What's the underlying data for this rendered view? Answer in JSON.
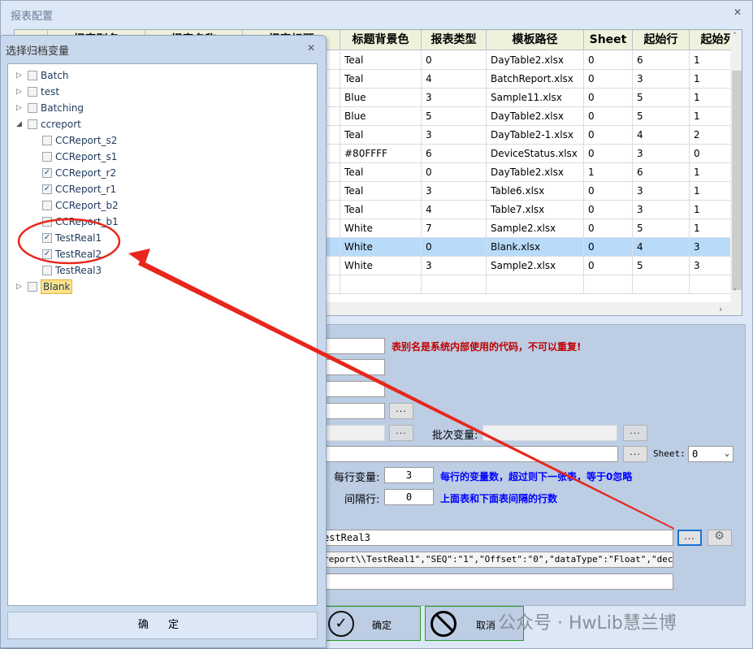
{
  "main_window": {
    "title": "报表配置",
    "close_icon": "close-icon"
  },
  "grid": {
    "columns": [
      "",
      "报表别名",
      "报表名称",
      "报表标题",
      "标题背景色",
      "报表类型",
      "模板路径",
      "Sheet",
      "起始行",
      "起始列"
    ],
    "rows": [
      {
        "bg": "Teal",
        "type": "0",
        "template": "DayTable2.xlsx",
        "sheet": "0",
        "start_row": "6",
        "start_col": "1"
      },
      {
        "bg": "Teal",
        "type": "4",
        "template": "BatchReport.xlsx",
        "sheet": "0",
        "start_row": "3",
        "start_col": "1"
      },
      {
        "bg": "Blue",
        "type": "3",
        "template": "Sample11.xlsx",
        "sheet": "0",
        "start_row": "5",
        "start_col": "1"
      },
      {
        "bg": "Blue",
        "type": "5",
        "template": "DayTable2.xlsx",
        "sheet": "0",
        "start_row": "5",
        "start_col": "1"
      },
      {
        "bg": "Teal",
        "type": "3",
        "template": "DayTable2-1.xlsx",
        "sheet": "0",
        "start_row": "4",
        "start_col": "2"
      },
      {
        "bg": "#80FFFF",
        "type": "6",
        "template": "DeviceStatus.xlsx",
        "sheet": "0",
        "start_row": "3",
        "start_col": "0"
      },
      {
        "bg": "Teal",
        "type": "0",
        "template": "DayTable2.xlsx",
        "sheet": "1",
        "start_row": "6",
        "start_col": "1"
      },
      {
        "bg": "Teal",
        "type": "3",
        "template": "Table6.xlsx",
        "sheet": "0",
        "start_row": "3",
        "start_col": "1"
      },
      {
        "bg": "Teal",
        "type": "4",
        "template": "Table7.xlsx",
        "sheet": "0",
        "start_row": "3",
        "start_col": "1"
      },
      {
        "bg": "White",
        "type": "7",
        "template": "Sample2.xlsx",
        "sheet": "0",
        "start_row": "5",
        "start_col": "1"
      },
      {
        "bg": "White",
        "type": "0",
        "template": "Blank.xlsx",
        "sheet": "0",
        "start_row": "4",
        "start_col": "3",
        "selected": true
      },
      {
        "bg": "White",
        "type": "3",
        "template": "Sample2.xlsx",
        "sheet": "0",
        "start_row": "5",
        "start_col": "3"
      }
    ]
  },
  "form": {
    "alias_hint": "表别名是系统内部使用的代码，不可以重复!",
    "browse_label": "...",
    "batch_var_label": "批次变量:",
    "sheet_label": "Sheet:",
    "sheet_value": "0",
    "vars_per_row_label": "每行变量:",
    "vars_per_row_value": "3",
    "vars_per_row_hint": "每行的变量数，超过则下一张表，等于0忽略",
    "gap_rows_label": "间隔行:",
    "gap_rows_value": "0",
    "gap_rows_hint": "上面表和下面表间隔的行数",
    "variables_value": "estReal3",
    "json_value": "report\\\\TestReal1\",\"SEQ\":\"1\",\"Offset\":\"0\",\"dataType\":\"Float\",\"decDigits",
    "ok_label": "确定",
    "cancel_label": "取消"
  },
  "dialog": {
    "title": "选择归档变量",
    "ok_label": "确 定",
    "tree": [
      {
        "label": "Batch",
        "level": 0,
        "expander": "collapsed",
        "checked": false
      },
      {
        "label": "test",
        "level": 0,
        "expander": "collapsed",
        "checked": false
      },
      {
        "label": "Batching",
        "level": 0,
        "expander": "collapsed",
        "checked": false
      },
      {
        "label": "ccreport",
        "level": 0,
        "expander": "expanded",
        "checked": false
      },
      {
        "label": "CCReport_s2",
        "level": 1,
        "checked": false
      },
      {
        "label": "CCReport_s1",
        "level": 1,
        "checked": false
      },
      {
        "label": "CCReport_r2",
        "level": 1,
        "checked": true
      },
      {
        "label": "CCReport_r1",
        "level": 1,
        "checked": true
      },
      {
        "label": "CCReport_b2",
        "level": 1,
        "checked": false
      },
      {
        "label": "CCReport_b1",
        "level": 1,
        "checked": false
      },
      {
        "label": "TestReal1",
        "level": 1,
        "checked": true
      },
      {
        "label": "TestReal2",
        "level": 1,
        "checked": true
      },
      {
        "label": "TestReal3",
        "level": 1,
        "checked": false
      },
      {
        "label": "Blank",
        "level": 0,
        "expander": "collapsed",
        "checked": false,
        "highlighted": true
      }
    ]
  },
  "watermark": "公众号 · HwLib慧兰博",
  "colors": {
    "annotation": "#e8261c",
    "selected_row": "#b9dbfa",
    "hint_red": "#c00000",
    "hint_blue": "#0000ff"
  }
}
